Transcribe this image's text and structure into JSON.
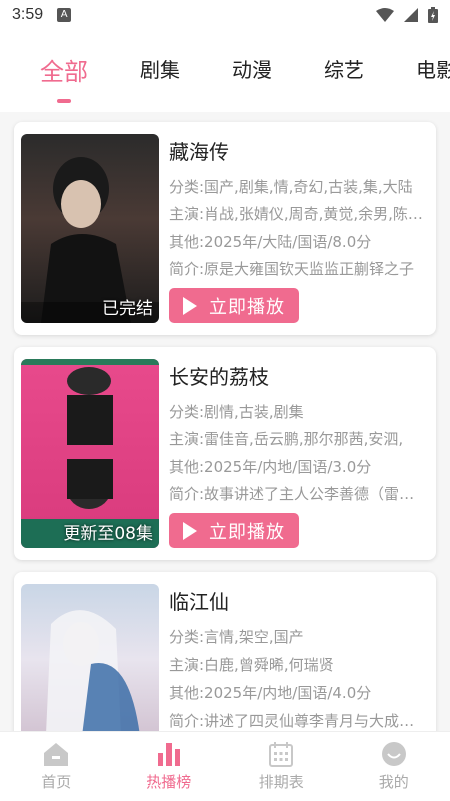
{
  "status_bar": {
    "time": "3:59",
    "badge": "A"
  },
  "tabs": [
    {
      "label": "全部",
      "active": true
    },
    {
      "label": "剧集",
      "active": false
    },
    {
      "label": "动漫",
      "active": false
    },
    {
      "label": "综艺",
      "active": false
    },
    {
      "label": "电影",
      "active": false
    }
  ],
  "items": [
    {
      "title": "藏海传",
      "category": "分类:国产,剧集,情,奇幻,古装,集,大陆",
      "cast": "主演:肖战,张婧仪,周奇,黄觉,余男,陈宥维",
      "other": "其他:2025年/大陆/国语/8.0分",
      "intro": "简介:原是大雍国钦天监监正蒯铎之子",
      "status": "已完结",
      "play_label": "立即播放"
    },
    {
      "title": "长安的荔枝",
      "category": "分类:剧情,古装,剧集",
      "cast": "主演:雷佳音,岳云鹏,那尔那茜,安泗,",
      "other": "其他:2025年/内地/国语/3.0分",
      "intro": "简介:故事讲述了主人公李善德（雷佳音",
      "status": "更新至08集",
      "play_label": "立即播放"
    },
    {
      "title": "临江仙",
      "category": "分类:言情,架空,国产",
      "cast": "主演:白鹿,曾舜晞,何瑞贤",
      "other": "其他:2025年/内地/国语/4.0分",
      "intro": "简介:讲述了四灵仙尊李青月与大成玄尊",
      "status": "",
      "play_label": "立即播放"
    }
  ],
  "bottom_nav": [
    {
      "label": "首页",
      "icon": "home-icon",
      "active": false
    },
    {
      "label": "热播榜",
      "icon": "chart-icon",
      "active": true
    },
    {
      "label": "排期表",
      "icon": "calendar-icon",
      "active": false
    },
    {
      "label": "我的",
      "icon": "profile-icon",
      "active": false
    }
  ],
  "colors": {
    "accent": "#f06b8f",
    "inactive": "#aaaaaa"
  }
}
